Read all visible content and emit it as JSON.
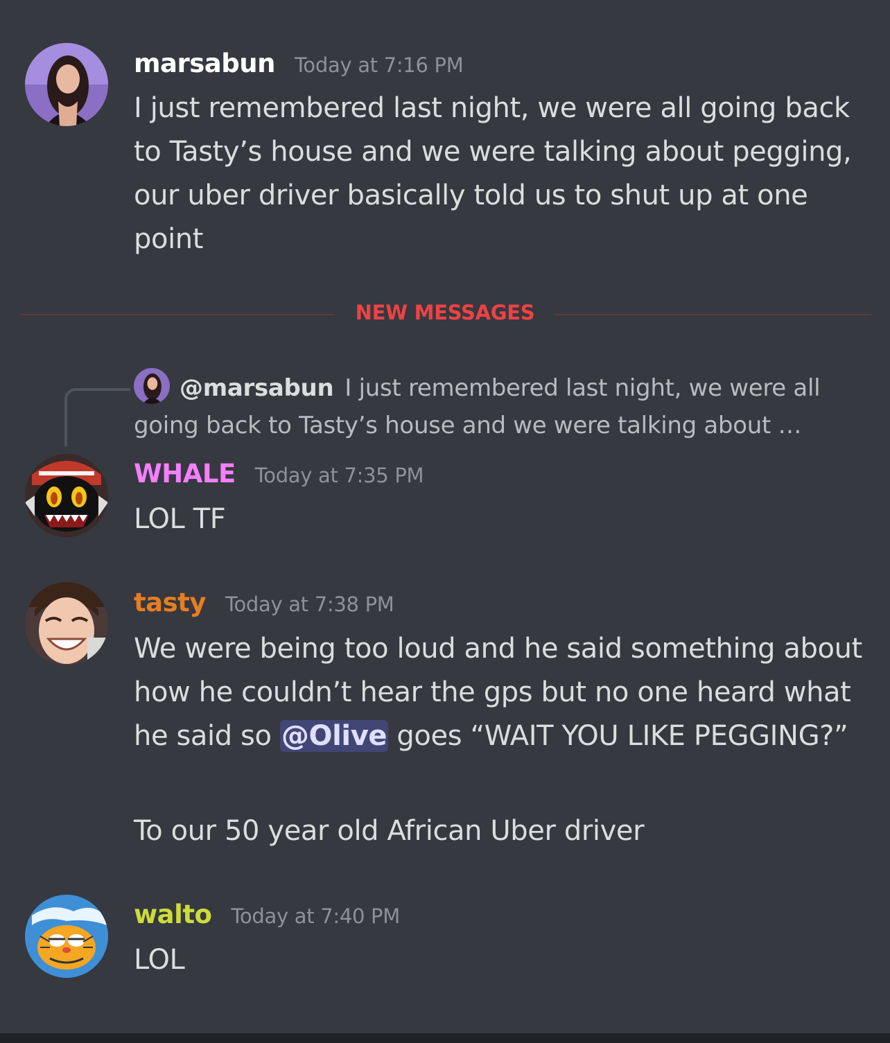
{
  "messages": [
    {
      "author": "marsabun",
      "author_color": "#ffffff",
      "timestamp": "Today at 7:16 PM",
      "text": "I just remembered last night, we were all going back to Tasty’s house and we were talking about pegging, our uber driver basically told us to shut up at one point"
    },
    {
      "author": "WHALE",
      "author_color": "#f47fff",
      "timestamp": "Today at 7:35 PM",
      "text": "LOL TF",
      "reply": {
        "author": "@marsabun",
        "preview": "I just remembered last night, we were all going back to Tasty’s house and we were talking about …"
      }
    },
    {
      "author": "tasty",
      "author_color": "#e67e22",
      "timestamp": "Today at 7:38 PM",
      "text_before_mention": "We were being too loud and he said something about how he couldn’t hear the gps but no one heard what he said so ",
      "mention": "@Olive",
      "text_after_mention": " goes “WAIT YOU LIKE PEGGING?”",
      "followup": "To our 50 year old African Uber driver"
    },
    {
      "author": "walto",
      "author_color": "#cddc39",
      "timestamp": "Today at 7:40 PM",
      "text": "LOL"
    }
  ],
  "divider": {
    "label": "NEW MESSAGES",
    "color": "#ed4245"
  },
  "avatars": [
    "marsabun-avatar",
    "whale-avatar",
    "tasty-avatar",
    "walto-avatar"
  ],
  "colors": {
    "background": "#36393f",
    "timestamp": "#8e9297",
    "mention_bg": "#414675"
  }
}
